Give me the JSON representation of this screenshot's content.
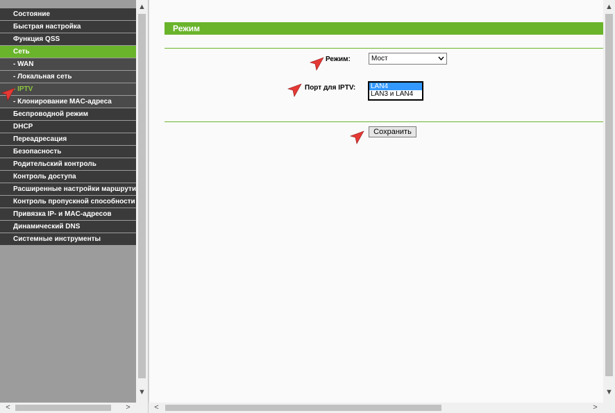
{
  "sidebar": {
    "items": [
      {
        "label": "Состояние"
      },
      {
        "label": "Быстрая настройка"
      },
      {
        "label": "Функция QSS"
      },
      {
        "label": "Сеть"
      },
      {
        "label": "- WAN"
      },
      {
        "label": "- Локальная сеть"
      },
      {
        "label": "- IPTV"
      },
      {
        "label": "- Клонирование MAC-адреса"
      },
      {
        "label": "Беспроводной режим"
      },
      {
        "label": "DHCP"
      },
      {
        "label": "Переадресация"
      },
      {
        "label": "Безопасность"
      },
      {
        "label": "Родительский контроль"
      },
      {
        "label": "Контроль доступа"
      },
      {
        "label": "Расширенные настройки маршрутизации"
      },
      {
        "label": "Контроль пропускной способности"
      },
      {
        "label": "Привязка IP- и MAC-адресов"
      },
      {
        "label": "Динамический DNS"
      },
      {
        "label": "Системные инструменты"
      }
    ]
  },
  "main": {
    "title": "Режим",
    "mode_label": "Режим:",
    "mode_value": "Мост",
    "port_label": "Порт для IPTV:",
    "port_options": [
      {
        "label": "LAN4"
      },
      {
        "label": "LAN3 и LAN4"
      }
    ],
    "save_label": "Сохранить"
  },
  "scrollbars": {
    "up": "▲",
    "down": "▼",
    "left": "<",
    "right": ">"
  },
  "colors": {
    "accent": "#6ab42c",
    "menu_bg": "#3a3a3a",
    "annotation": "#e53935"
  }
}
